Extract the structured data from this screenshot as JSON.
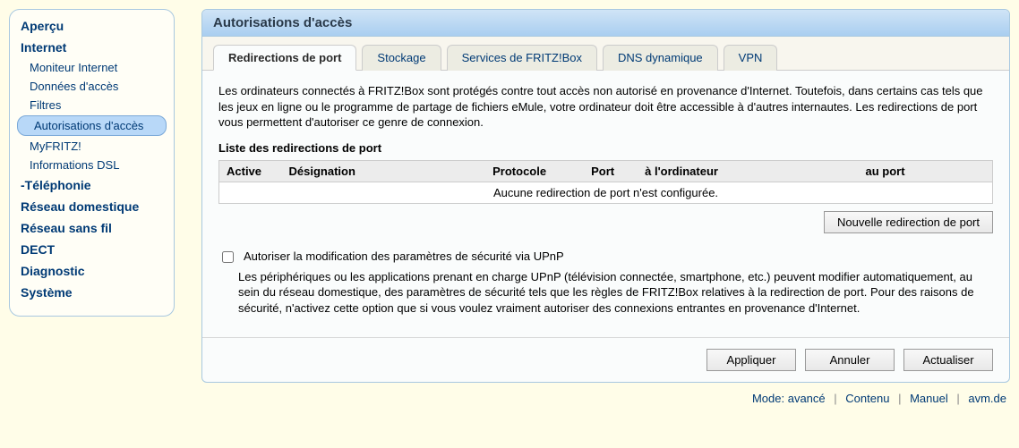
{
  "sidebar": {
    "items": [
      {
        "label": "Aperçu",
        "type": "top"
      },
      {
        "label": "Internet",
        "type": "top"
      },
      {
        "label": "Moniteur Internet",
        "type": "sub"
      },
      {
        "label": "Données d'accès",
        "type": "sub"
      },
      {
        "label": "Filtres",
        "type": "sub"
      },
      {
        "label": "Autorisations d'accès",
        "type": "sub",
        "active": true
      },
      {
        "label": "MyFRITZ!",
        "type": "sub"
      },
      {
        "label": "Informations DSL",
        "type": "sub"
      },
      {
        "label": "-Téléphonie",
        "type": "top"
      },
      {
        "label": "Réseau domestique",
        "type": "top"
      },
      {
        "label": "Réseau sans fil",
        "type": "top"
      },
      {
        "label": "DECT",
        "type": "top"
      },
      {
        "label": "Diagnostic",
        "type": "top"
      },
      {
        "label": "Système",
        "type": "top"
      }
    ]
  },
  "panel": {
    "title": "Autorisations d'accès"
  },
  "tabs": [
    {
      "label": "Redirections de port",
      "active": true
    },
    {
      "label": "Stockage"
    },
    {
      "label": "Services de FRITZ!Box"
    },
    {
      "label": "DNS dynamique"
    },
    {
      "label": "VPN"
    }
  ],
  "content": {
    "intro": "Les ordinateurs connectés à FRITZ!Box sont protégés contre tout accès non autorisé en provenance d'Internet. Toutefois, dans certains cas tels que les jeux en ligne ou le programme de partage de fichiers eMule, votre ordinateur doit être accessible à d'autres internautes. Les redirections de port vous permettent d'autoriser ce genre de connexion.",
    "list_heading": "Liste des redirections de port",
    "table": {
      "headers": [
        "Active",
        "Désignation",
        "Protocole",
        "Port",
        "à l'ordinateur",
        "au port"
      ],
      "empty_message": "Aucune redirection de port n'est configurée."
    },
    "new_button": "Nouvelle redirection de port",
    "upnp": {
      "label": "Autoriser la modification des paramètres de sécurité via UPnP",
      "help": "Les périphériques ou les applications prenant en charge UPnP (télévision connectée, smartphone, etc.) peuvent modifier automatiquement, au sein du réseau domestique, des paramètres de sécurité tels que les règles de FRITZ!Box relatives à la redirection de port. Pour des raisons de sécurité, n'activez cette option que si vous voulez vraiment autoriser des connexions entrantes en provenance d'Internet."
    }
  },
  "actions": {
    "apply": "Appliquer",
    "cancel": "Annuler",
    "refresh": "Actualiser"
  },
  "footer": {
    "mode_label": "Mode:",
    "mode_value": "avancé",
    "contents": "Contenu",
    "manual": "Manuel",
    "avm": "avm.de"
  }
}
